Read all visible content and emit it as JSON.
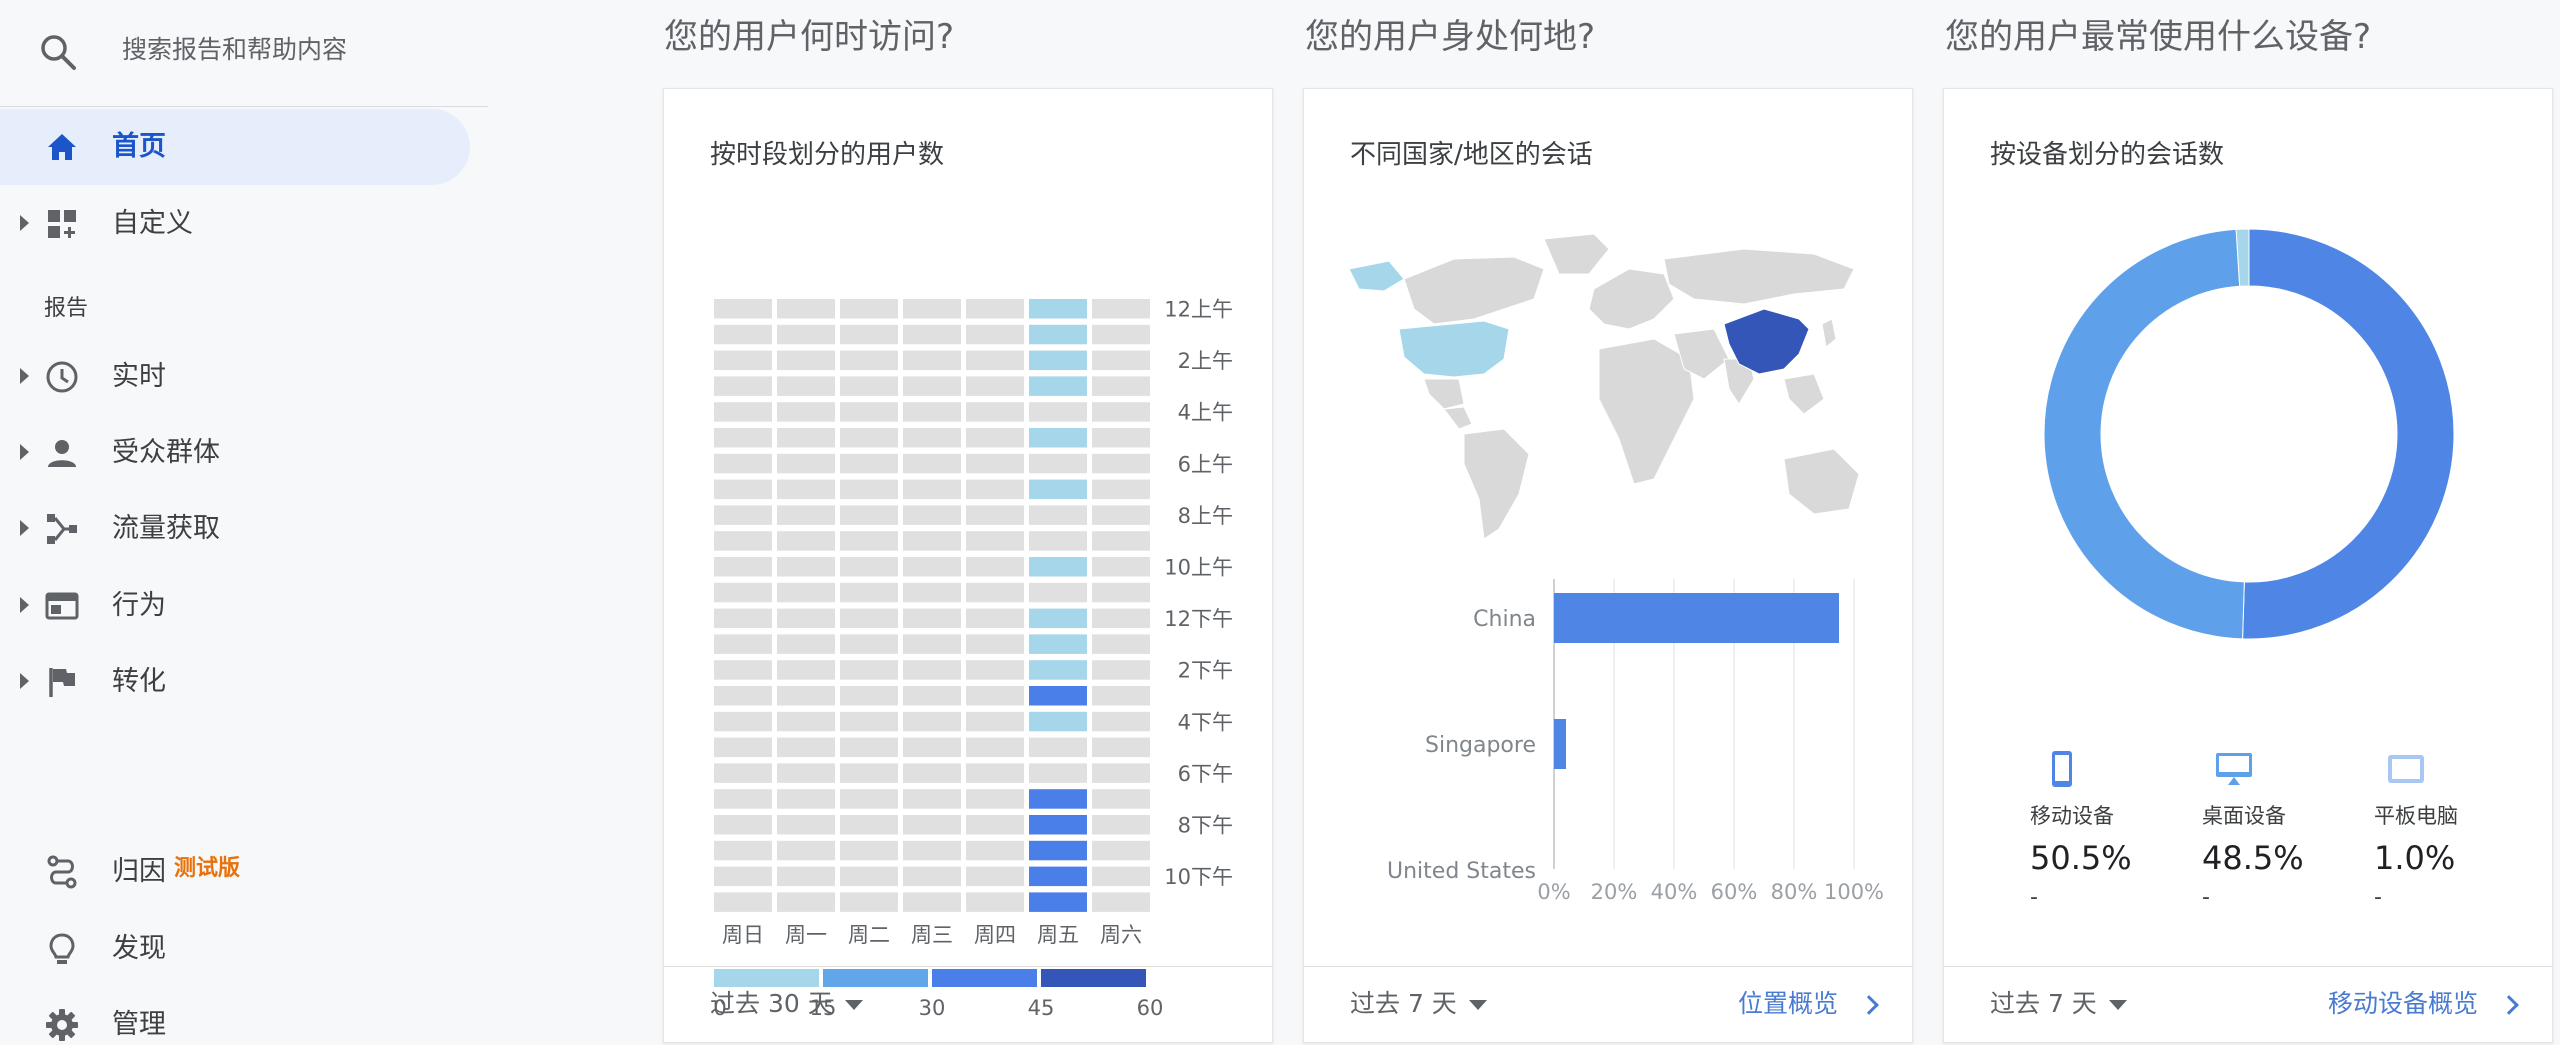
{
  "search": {
    "placeholder": "搜索报告和帮助内容"
  },
  "nav": {
    "home": "首页",
    "customize": "自定义",
    "reports_header": "报告",
    "realtime": "实时",
    "audience": "受众群体",
    "acquisition": "流量获取",
    "behavior": "行为",
    "conversions": "转化",
    "attribution": "归因",
    "beta": "测试版",
    "discover": "发现",
    "admin": "管理"
  },
  "sections": {
    "when": "您的用户何时访问?",
    "where": "您的用户身处何地?",
    "devices": "您的用户最常使用什么设备?"
  },
  "cards": {
    "heatmap": {
      "title": "按时段划分的用户数",
      "period": "过去 30 天"
    },
    "geo": {
      "title": "不同国家/地区的会话",
      "period": "过去 7 天",
      "link": "位置概览"
    },
    "device": {
      "title": "按设备划分的会话数",
      "period": "过去 7 天",
      "link": "移动设备概览"
    }
  },
  "colors": {
    "accent": "#1a56c9",
    "cell_empty": "#e0e0e0",
    "scale": [
      "#a6d6ea",
      "#62a6ea",
      "#4a7ee8",
      "#3556b9"
    ],
    "geo_light": "#a6d6ea",
    "geo_dark": "#3556b9",
    "donut_mobile": "#4f86e6",
    "donut_desktop": "#5ea1ea",
    "donut_tablet": "#a6d6ea"
  },
  "icons": {
    "search": "search-icon",
    "home": "home-icon",
    "customize": "dashboard-add-icon",
    "realtime": "clock-icon",
    "audience": "person-icon",
    "acquisition": "branch-icon",
    "behavior": "browser-window-icon",
    "conversions": "flag-icon",
    "attribution": "route-icon",
    "discover": "lightbulb-icon",
    "admin": "gear-icon"
  },
  "chart_data": [
    {
      "type": "heatmap",
      "title": "按时段划分的用户数",
      "x_categories": [
        "周日",
        "周一",
        "周二",
        "周三",
        "周四",
        "周五",
        "周六"
      ],
      "y_tick_labels": [
        "12上午",
        "2上午",
        "4上午",
        "6上午",
        "8上午",
        "10上午",
        "12下午",
        "2下午",
        "4下午",
        "6下午",
        "8下午",
        "10下午"
      ],
      "legend_ticks": [
        "0",
        "15",
        "30",
        "45",
        "60"
      ],
      "scale_range": [
        0,
        60
      ],
      "rows": 24,
      "values_friday_by_hour": [
        10,
        10,
        10,
        10,
        0,
        10,
        0,
        10,
        0,
        0,
        10,
        0,
        10,
        10,
        10,
        40,
        10,
        0,
        0,
        30,
        40,
        40,
        30,
        30
      ],
      "other_days": "0"
    },
    {
      "type": "bar",
      "title": "不同国家/地区的会话",
      "categories": [
        "China",
        "Singapore",
        "United States"
      ],
      "values": [
        95,
        4,
        0
      ],
      "x_tick_labels": [
        "0%",
        "20%",
        "40%",
        "60%",
        "80%",
        "100%"
      ],
      "xlim": [
        0,
        100
      ]
    },
    {
      "type": "pie",
      "title": "按设备划分的会话数",
      "categories": [
        "移动设备",
        "桌面设备",
        "平板电脑"
      ],
      "display_values": [
        "50.5%",
        "48.5%",
        "1.0%"
      ],
      "values": [
        50.5,
        48.5,
        1.0
      ],
      "sub_values": [
        "-",
        "-",
        "-"
      ]
    }
  ]
}
